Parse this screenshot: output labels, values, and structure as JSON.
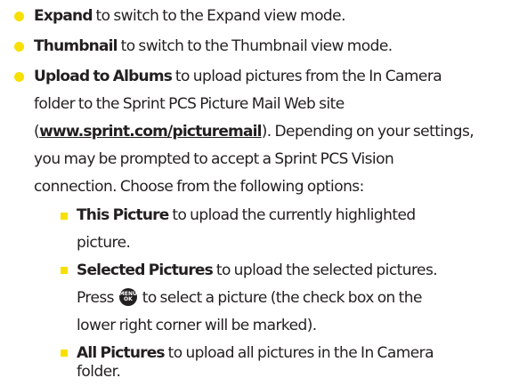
{
  "items": [
    {
      "term": "Expand",
      "text": " to switch to the Expand view mode."
    },
    {
      "term": "Thumbnail",
      "text": " to switch to the Thumbnail view mode."
    },
    {
      "term": "Upload to Albums",
      "lines": [
        " to upload pictures from the In Camera",
        "folder to the Sprint PCS Picture Mail Web site",
        "). Depending on your settings,",
        "you may be prompted to accept a Sprint PCS Vision",
        "connection. Choose from the following options:"
      ],
      "link": "www.sprint.com/picturemail",
      "link_prefix": "("
    }
  ],
  "sub_items": [
    {
      "term": "This Picture",
      "lines": [
        " to upload the currently highlighted",
        "picture."
      ]
    },
    {
      "term": "Selected Pictures",
      "lines": [
        " to upload the selected pictures.",
        "Press ",
        " to select a picture (the check box on the",
        "lower right corner will be marked)."
      ],
      "key_icon": "menu-ok-key-icon",
      "key_label_top": "MENU",
      "key_label_bottom": "OK"
    },
    {
      "term": "All Pictures",
      "lines": [
        " to upload all pictures in the In Camera",
        "folder."
      ]
    }
  ],
  "colors": {
    "bullet": "#f7e000",
    "text": "#231f20"
  }
}
